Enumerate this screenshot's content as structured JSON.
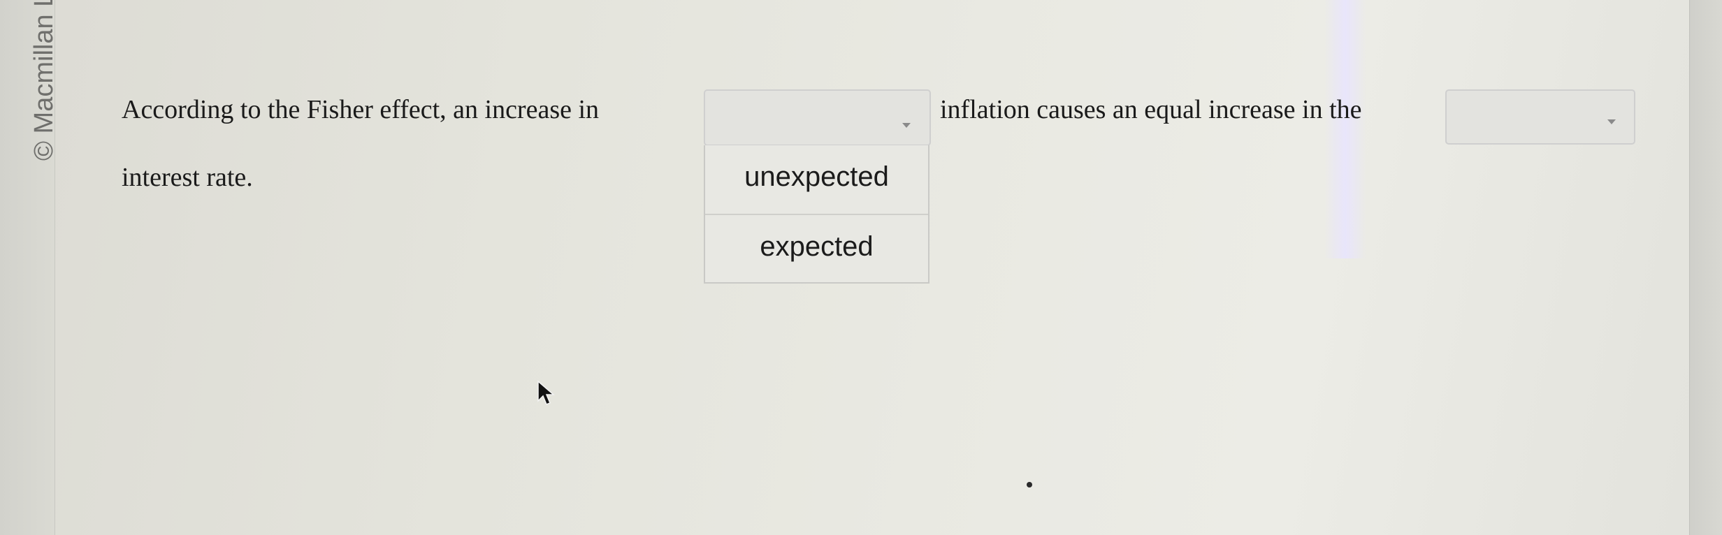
{
  "copyright": "© Macmillan L",
  "question": {
    "text_before": "According to the Fisher effect, an increase in",
    "text_middle": "inflation causes an equal increase in the",
    "text_after": "interest rate."
  },
  "dropdown_1": {
    "value": "",
    "options": [
      "unexpected",
      "expected"
    ],
    "expanded": true
  },
  "dropdown_2": {
    "value": "",
    "expanded": false
  },
  "icons": {
    "caret": "chevron-down-icon",
    "cursor": "mouse-pointer-icon"
  }
}
